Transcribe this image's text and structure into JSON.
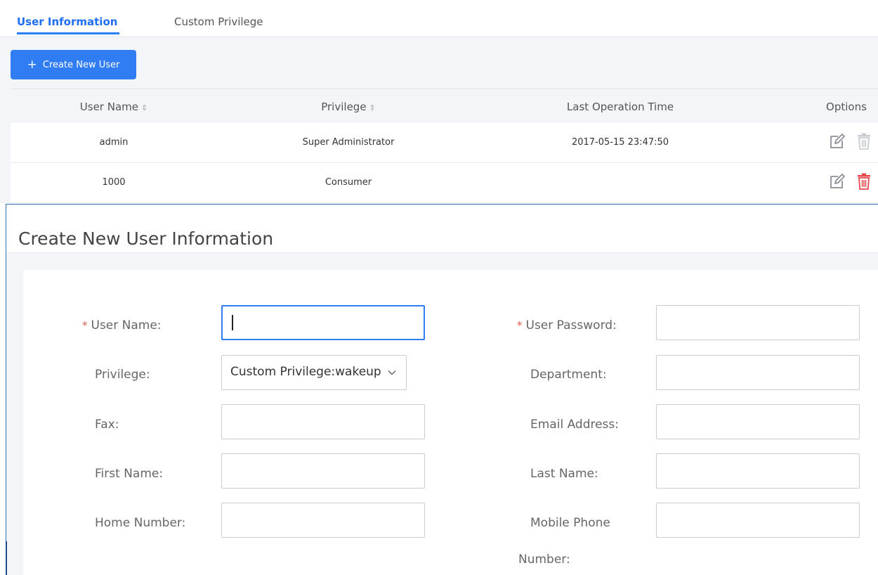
{
  "tabs": [
    {
      "label": "User Information",
      "active": true
    },
    {
      "label": "Custom Privilege",
      "active": false
    }
  ],
  "toolbar": {
    "create_button": "Create New User",
    "create_icon": "+"
  },
  "table": {
    "columns": [
      "User Name",
      "Privilege",
      "Last Operation Time",
      "Options"
    ],
    "sort_icon": "⇕",
    "rows": [
      {
        "user_name": "admin",
        "privilege": "Super Administrator",
        "last_operation_time": "2017-05-15 23:47:50",
        "delete_enabled": false
      },
      {
        "user_name": "1000",
        "privilege": "Consumer",
        "last_operation_time": "",
        "delete_enabled": true
      }
    ]
  },
  "form": {
    "title": "Create New User Information",
    "required_mark": "*",
    "fields": {
      "user_name": {
        "label": "User Name:",
        "value": ""
      },
      "user_password": {
        "label": "User Password:",
        "value": ""
      },
      "privilege": {
        "label": "Privilege:",
        "value": "Custom Privilege:wakeup"
      },
      "department": {
        "label": "Department:",
        "value": ""
      },
      "fax": {
        "label": "Fax:",
        "value": ""
      },
      "email": {
        "label": "Email Address:",
        "value": ""
      },
      "first_name": {
        "label": "First Name:",
        "value": ""
      },
      "last_name": {
        "label": "Last Name:",
        "value": ""
      },
      "home_number": {
        "label": "Home Number:",
        "value": ""
      },
      "mobile_phone_line1": "Mobile Phone",
      "mobile_phone_line2": "Number:"
    }
  },
  "colors": {
    "accent": "#2f7cf3",
    "required": "#e05a52",
    "delete_active": "#e5484d",
    "delete_disabled": "#c8ccd2"
  }
}
